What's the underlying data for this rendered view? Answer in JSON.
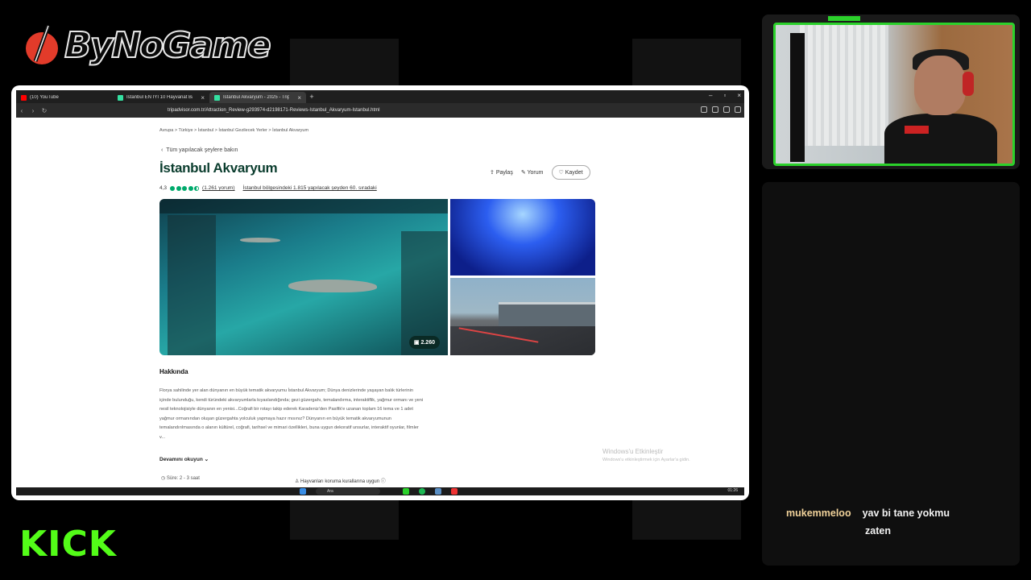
{
  "logo": {
    "text": "ByNoGame"
  },
  "platform": {
    "text": "KICK"
  },
  "browser": {
    "tabs": [
      {
        "label": "(10) YouTube",
        "favicon_color": "#ff0000",
        "active": false
      },
      {
        "label": "İstanbul EN İYİ 10 Hayvanat Bahç",
        "favicon_color": "#34e0a1",
        "active": false
      },
      {
        "label": "İstanbul Akvaryum - 2025 - Tripa",
        "favicon_color": "#34e0a1",
        "active": true
      }
    ],
    "url": "tripadvisor.com.tr/Attraction_Review-g293974-d2198171-Reviews-Istanbul_Akvaryum-Istanbul.html"
  },
  "page": {
    "breadcrumb": "Avrupa  >  Türkiye  >  İstanbul  >  İstanbul Gezilecek Yerler  >  İstanbul Akvaryum",
    "back_link": "Tüm yapılacak şeylere bakın",
    "title": "İstanbul Akvaryum",
    "rating_value": "4,3",
    "rating_fraction": 0.86,
    "reviews": "(1.261 yorum)",
    "ranking": "İstanbul bölgesindeki 1.815 yapılacak şeyden 60. sıradaki",
    "actions": {
      "share": "Paylaş",
      "review": "Yorum",
      "save": "Kaydet"
    },
    "photo_count": "2.260",
    "about_heading": "Hakkında",
    "about_text": "Florya sahilinde yer alan dünyanın en büyük tematik akvaryumu İstanbul Akvaryum; Dünya denizlerinde yaşayan balık türlerinin içinde bulunduğu, kendi türündeki akvaryumlarla kıyaslandığında; gezi güzergahı, temalandırma, interaktiflik, yağmur ormanı ve yeni nesil teknolojisiyle dünyanın en yenisi...Coğrafi bir rotayı takip ederek Karadeniz'den Pasifik'e uzanan toplam 16 tema ve 1 adet yağmur ormanından oluşan güzergahta yolculuk yapmaya hazır mısınız? Dünyanın en büyük tematik akvaryumunun temalandırılmasında o alanın kültürel, coğrafi, tarihsel ve mimari özellikleri, buna uygun dekoratif unsurlar, interaktif oyunlar, filmler v...",
    "read_more": "Devamını okuyun",
    "duration": "Süre: 2 - 3 saat",
    "animal_rules": "Hayvanları koruma kurallarına uygun",
    "windows_activation_title": "Windows'u Etkinleştir",
    "windows_activation_sub": "Windows'u etkinleştirmek için Ayarlar'a gidin."
  },
  "taskbar": {
    "search_placeholder": "Ara",
    "time": "01:26"
  },
  "chat": {
    "username": "mukemmeloo",
    "message_line1": "yav bi tane yokmu",
    "message_line2": "zaten",
    "username_color": "#f1d29a"
  },
  "colors": {
    "kick_green": "#53fc18",
    "cam_border": "#2bd12b",
    "tripadvisor_green": "#00aa6c"
  }
}
